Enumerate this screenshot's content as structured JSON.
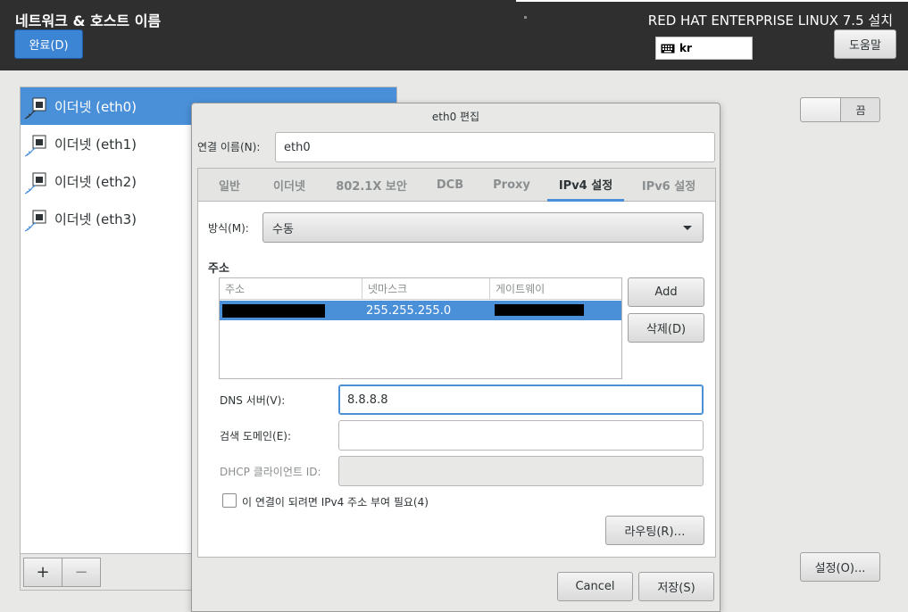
{
  "header": {
    "title": "네트워크 & 호스트 이름",
    "done_label": "완료(D)",
    "product": "RED HAT ENTERPRISE LINUX 7.5 설치",
    "keyboard_layout": "kr",
    "help_label": "도움말"
  },
  "devices": {
    "items": [
      {
        "label": "이더넷 (eth0)",
        "selected": true
      },
      {
        "label": "이더넷 (eth1)",
        "selected": false
      },
      {
        "label": "이더넷 (eth2)",
        "selected": false
      },
      {
        "label": "이더넷 (eth3)",
        "selected": false
      }
    ],
    "add_label": "+",
    "remove_label": "−"
  },
  "device_detail": {
    "toggle_state_label": "끔",
    "settings_label": "설정(O)..."
  },
  "dialog": {
    "title": "eth0 편집",
    "conn_name_label": "연결 이름(N):",
    "conn_name_value": "eth0",
    "tabs": [
      {
        "label": "일반",
        "active": false
      },
      {
        "label": "이더넷",
        "active": false
      },
      {
        "label": "802.1X 보안",
        "active": false
      },
      {
        "label": "DCB",
        "active": false
      },
      {
        "label": "Proxy",
        "active": false
      },
      {
        "label": "IPv4 설정",
        "active": true
      },
      {
        "label": "IPv6 설정",
        "active": false
      }
    ],
    "method_label": "방식(M):",
    "method_value": "수동",
    "address_section": "주소",
    "columns": [
      "주소",
      "넷마스크",
      "게이트웨이"
    ],
    "rows": [
      {
        "address": "",
        "netmask": "255.255.255.0",
        "gateway": ""
      }
    ],
    "add_label": "Add",
    "delete_label": "삭제(D)",
    "dns_label": "DNS 서버(V):",
    "dns_value": "8.8.8.8",
    "search_label": "검색 도메인(E):",
    "search_value": "",
    "dhcp_label": "DHCP 클라이언트 ID:",
    "dhcp_value": "",
    "require_ipv4_label": "이 연결이 되려면 IPv4 주소 부여 필요(4)",
    "require_ipv4_checked": false,
    "routes_label": "라우팅(R)…",
    "cancel_label": "Cancel",
    "save_label": "저장(S)"
  },
  "colors": {
    "accent": "#4a90d9",
    "header_bg": "#2f2f2f",
    "done_button": "#3c84d4"
  }
}
